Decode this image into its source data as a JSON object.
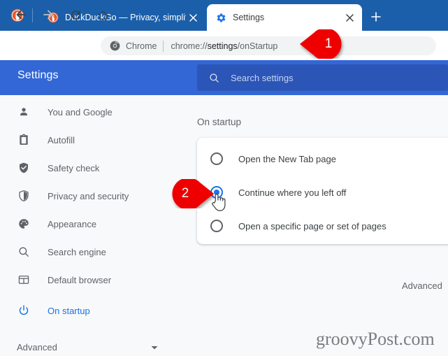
{
  "browser": {
    "tabs": [
      {
        "name": "pinned-duckduckgo",
        "title": "",
        "favicon": "duckduckgo-icon",
        "active": false,
        "pinned": true
      },
      {
        "name": "duckduckgo",
        "title": "DuckDuckGo — Privacy, simplifie",
        "favicon": "duckduckgo-icon",
        "active": false,
        "pinned": false
      },
      {
        "name": "settings",
        "title": "Settings",
        "favicon": "gear-icon",
        "active": true,
        "pinned": false
      }
    ],
    "new_tab_label": "+",
    "nav": {
      "back": "back-arrow-icon",
      "forward": "forward-arrow-icon",
      "reload": "reload-icon",
      "home": "home-icon"
    },
    "omnibox": {
      "security_icon": "chrome-logo-icon",
      "chip_label": "Chrome",
      "url_prefix": "chrome://",
      "url_strong": "settings",
      "url_suffix": "/onStartup"
    }
  },
  "settings": {
    "header": {
      "title": "Settings",
      "search_icon": "search-icon",
      "search_placeholder": "Search settings",
      "search_value": ""
    },
    "sidebar": {
      "items": [
        {
          "label": "You and Google",
          "icon": "person-icon",
          "selected": false
        },
        {
          "label": "Autofill",
          "icon": "clipboard-icon",
          "selected": false
        },
        {
          "label": "Safety check",
          "icon": "shield-check-icon",
          "selected": false
        },
        {
          "label": "Privacy and security",
          "icon": "shield-half-icon",
          "selected": false
        },
        {
          "label": "Appearance",
          "icon": "palette-icon",
          "selected": false
        },
        {
          "label": "Search engine",
          "icon": "search-icon",
          "selected": false
        },
        {
          "label": "Default browser",
          "icon": "browser-window-icon",
          "selected": false
        },
        {
          "label": "On startup",
          "icon": "power-icon",
          "selected": true
        }
      ],
      "advanced": {
        "label": "Advanced",
        "chevron": "chevron-down-icon"
      }
    },
    "main": {
      "section_title": "On startup",
      "options": [
        {
          "label": "Open the New Tab page",
          "checked": false
        },
        {
          "label": "Continue where you left off",
          "checked": true
        },
        {
          "label": "Open a specific page or set of pages",
          "checked": false
        }
      ],
      "advanced_link": "Advanced"
    }
  },
  "callouts": [
    {
      "number": "1",
      "direction": "left",
      "color": "#ee0000"
    },
    {
      "number": "2",
      "direction": "right",
      "color": "#ee0000"
    }
  ],
  "cursor": {
    "type": "pointing-hand-cursor"
  },
  "watermark": {
    "text": "groovyPost.com"
  },
  "colors": {
    "tabstrip_blue": "#1b5faa",
    "settings_header_blue": "#3367d6",
    "search_box_blue": "#2b56b7",
    "accent_blue": "#1a73e8",
    "callout_red": "#ee0000",
    "page_bg": "#f8f9fa",
    "card_white": "#ffffff",
    "omnibox_gray": "#f1f3f4",
    "text_gray": "#5f6368",
    "text_dark": "#3c4043"
  }
}
